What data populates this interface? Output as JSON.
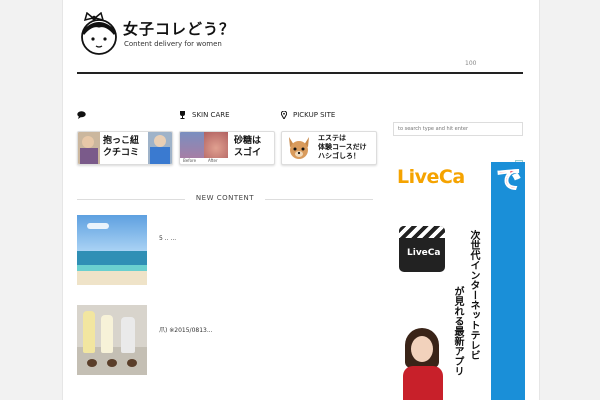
{
  "site": {
    "title": "女子コレどう？",
    "subtitle": "Content delivery for women",
    "counter": "100"
  },
  "categories": [
    {
      "label": "",
      "icon": "chat-bubble-icon"
    },
    {
      "label": "SKIN CARE",
      "icon": "trophy-icon"
    },
    {
      "label": "PICKUP SITE",
      "icon": "map-pin-icon"
    }
  ],
  "banners": [
    {
      "text_line1": "抱っこ紐",
      "text_line2": "クチコミ"
    },
    {
      "text_line1": "砂糖は",
      "text_line2": "スゴイ",
      "caption_before": "Before",
      "caption_after": "After"
    },
    {
      "text_line1": "エステは",
      "text_line2": "体験コースだけ",
      "text_line3": "ハシゴしろ！"
    }
  ],
  "section": {
    "label": "NEW CONTENT"
  },
  "posts": [
    {
      "title": "5 .. ..."
    },
    {
      "title": "爪) ※2015/0813..."
    }
  ],
  "search": {
    "placeholder": "to search type and hit enter"
  },
  "ad": {
    "brand": "LiveCa",
    "app_label": "LiveCa",
    "headline": "日本のテレビを海外で",
    "copy_line1": "次世代インターネットテレビ",
    "copy_line2": "が見れる最新アプリ"
  },
  "colors": {
    "accent_orange": "#f5a300",
    "ad_red": "#e0001b",
    "ad_blue": "#1a8fd8"
  }
}
